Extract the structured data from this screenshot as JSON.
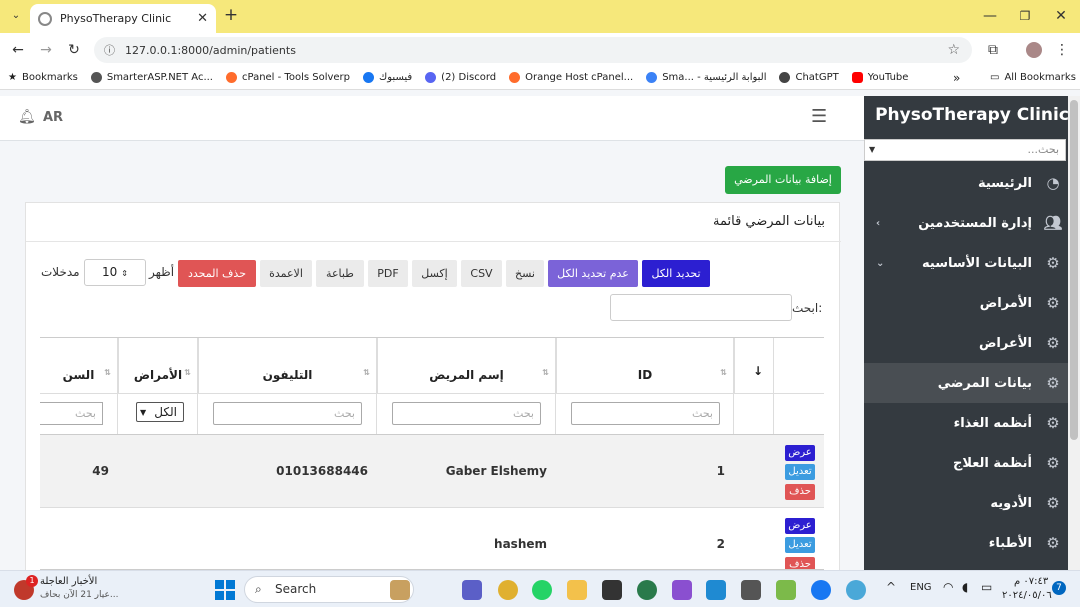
{
  "browser": {
    "tab_title": "PhysoTherapy Clinic",
    "new_tab": "+",
    "url": "127.0.0.1:8000/admin/patients",
    "bookmarks": [
      {
        "label": "Bookmarks",
        "color": "#222222"
      },
      {
        "label": "SmarterASP.NET Ac...",
        "color": "#555555"
      },
      {
        "label": "cPanel - Tools Solverp",
        "color": "#ff6c2c"
      },
      {
        "label": "فيسبوك",
        "color": "#1877f2"
      },
      {
        "label": "(2) Discord",
        "color": "#5865f2"
      },
      {
        "label": "Orange Host cPanel...",
        "color": "#ff6c2c"
      },
      {
        "label": "Sma... - البوابة الرئيسية",
        "color": "#3b82f6"
      },
      {
        "label": "ChatGPT",
        "color": "#444444"
      },
      {
        "label": "YouTube",
        "color": "#ff0000"
      }
    ],
    "all_bookmarks": "All Bookmarks"
  },
  "header": {
    "lang": "AR"
  },
  "sidebar": {
    "brand": "PhysoTherapy Clinic",
    "search_placeholder": "بحث...",
    "items": [
      {
        "label": "الرئيسية",
        "icon": "dashboard-icon",
        "arrow": ""
      },
      {
        "label": "إدارة المستخدمين",
        "icon": "users-icon",
        "arrow": "‹"
      },
      {
        "label": "البيانات الأساسيه",
        "icon": "cogs-icon",
        "arrow": "⌄"
      },
      {
        "label": "الأمراض",
        "icon": "cogs-icon",
        "arrow": ""
      },
      {
        "label": "الأعراض",
        "icon": "cogs-icon",
        "arrow": ""
      },
      {
        "label": "بيانات المرضي",
        "icon": "cogs-icon",
        "arrow": ""
      },
      {
        "label": "أنظمه الغذاء",
        "icon": "cogs-icon",
        "arrow": ""
      },
      {
        "label": "أنظمة العلاج",
        "icon": "cogs-icon",
        "arrow": ""
      },
      {
        "label": "الأدويه",
        "icon": "cogs-icon",
        "arrow": ""
      },
      {
        "label": "الأطباء",
        "icon": "cogs-icon",
        "arrow": ""
      }
    ]
  },
  "main": {
    "add_button": "إضافة بيانات المرضي",
    "card_title": "بيانات المرضي قائمة",
    "buttons": {
      "select_all": "تحديد الكل",
      "deselect_all": "عدم تحديد الكل",
      "copy": "نسخ",
      "csv": "CSV",
      "excel": "إكسل",
      "pdf": "PDF",
      "print": "طباعة",
      "columns": "الاعمدة",
      "delete_selected": "حذف المحدد"
    },
    "show_label": "أظهر",
    "page_length": "10",
    "entries_label": "مدخلات",
    "search_label": "ابحث:",
    "table": {
      "headers": {
        "id": "ID",
        "name": "إسم المريض",
        "phone": "التليفون",
        "diseases": "الأمراض",
        "age": "السن"
      },
      "filter_placeholder": "بحث",
      "filter_select": "الكل",
      "actions": {
        "view": "عرض",
        "edit": "تعديل",
        "delete": "حذف"
      },
      "rows": [
        {
          "id": "1",
          "name": "Gaber Elshemy",
          "phone": "01013688446",
          "diseases": "",
          "age": "49"
        },
        {
          "id": "2",
          "name": "hashem",
          "phone": "",
          "diseases": "",
          "age": ""
        }
      ]
    }
  },
  "taskbar": {
    "news_title": "الأخبار العاجلة",
    "news_sub": "عيار 21 الآن بحاف...",
    "news_badge": "1",
    "search": "Search",
    "lang": "ENG",
    "time": "٠٧:٤٣ م",
    "date": "٢٠٢٤/٠٥/٠٦",
    "notif": "7"
  },
  "colors": {
    "sidebar": "#343a40",
    "add_button": "#28a745",
    "select_all": "#2c1fd1",
    "deselect_all": "#7b63d8",
    "delete_selected": "#e05555",
    "view": "#2c1fd1",
    "edit": "#3c9ce0",
    "delete": "#e05555"
  }
}
